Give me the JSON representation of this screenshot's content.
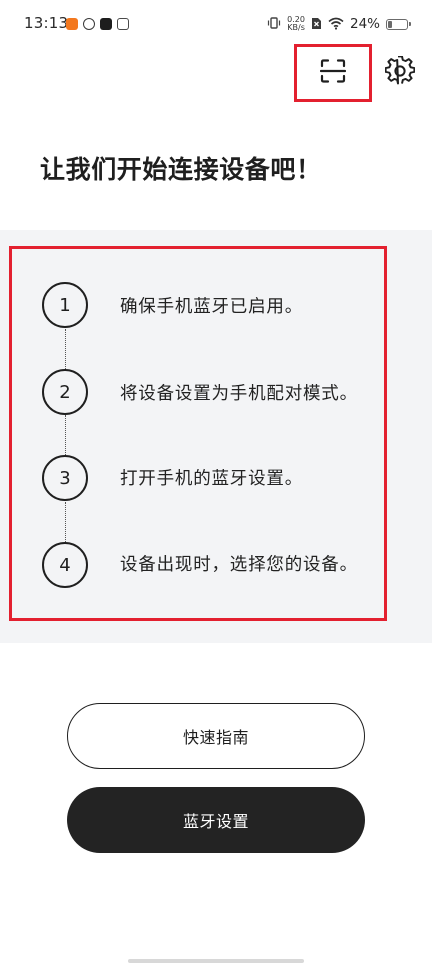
{
  "status_bar": {
    "time": "13:13",
    "app_icons": [
      "xiaomi-app-icon",
      "sync-app-icon",
      "tiktok-icon",
      "robot-app-icon"
    ],
    "net_speed_value": "0.20",
    "net_speed_unit": "KB/s",
    "battery_percent": "24%",
    "battery_level": 0.24
  },
  "header": {
    "scan_icon": "scan-icon",
    "settings_icon": "gear-icon"
  },
  "title": "让我们开始连接设备吧！",
  "steps": [
    {
      "number": "1",
      "text": "确保手机蓝牙已启用。"
    },
    {
      "number": "2",
      "text": "将设备设置为手机配对模式。"
    },
    {
      "number": "3",
      "text": "打开手机的蓝牙设置。"
    },
    {
      "number": "4",
      "text": "设备出现时，选择您的设备。"
    }
  ],
  "buttons": {
    "quick_guide": "快速指南",
    "bluetooth_settings": "蓝牙设置"
  },
  "colors": {
    "highlight": "#e3202f",
    "panel_bg": "#f3f4f6",
    "primary_dark": "#232323"
  }
}
